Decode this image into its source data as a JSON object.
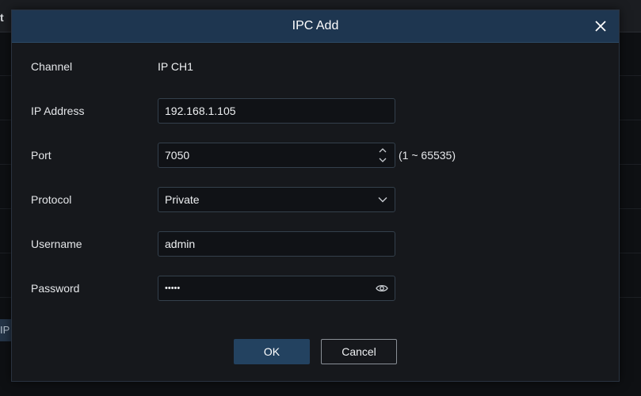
{
  "background": {
    "header_fragment": "t",
    "side_button_label": "IP"
  },
  "dialog": {
    "title": "IPC Add",
    "close_icon": "close-icon"
  },
  "form": {
    "channel": {
      "label": "Channel",
      "value": "IP CH1"
    },
    "ip_address": {
      "label": "IP Address",
      "value": "192.168.1.105"
    },
    "port": {
      "label": "Port",
      "value": "7050",
      "range_hint": "(1 ~ 65535)"
    },
    "protocol": {
      "label": "Protocol",
      "value": "Private"
    },
    "username": {
      "label": "Username",
      "value": "admin"
    },
    "password": {
      "label": "Password",
      "value": "•••••"
    }
  },
  "buttons": {
    "ok_label": "OK",
    "cancel_label": "Cancel"
  },
  "colors": {
    "header_bg": "#1e3650",
    "ok_bg": "#234260",
    "dialog_bg": "#16181c"
  }
}
